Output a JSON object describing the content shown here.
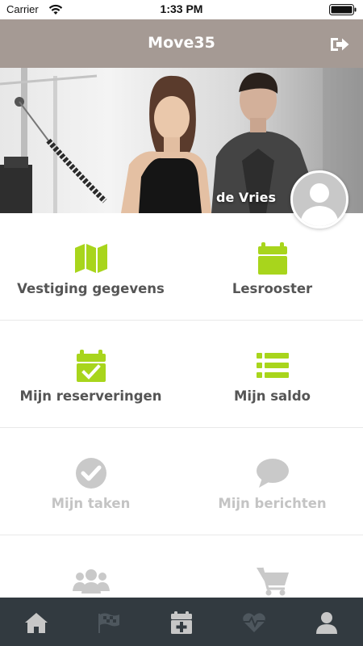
{
  "status_bar": {
    "carrier": "Carrier",
    "time": "1:33 PM"
  },
  "header": {
    "title": "Move35",
    "logout_icon": "sign-out-icon"
  },
  "profile": {
    "name": "de Vries",
    "avatar_icon": "user-avatar-icon"
  },
  "colors": {
    "accent": "#a8d51c",
    "header_bg": "#a59a94",
    "tabbar_bg": "#323a40",
    "muted": "#c9c9c9"
  },
  "menu": [
    {
      "label": "Vestiging gegevens",
      "icon": "map-icon",
      "enabled": true
    },
    {
      "label": "Lesrooster",
      "icon": "calendar-icon",
      "enabled": true
    },
    {
      "label": "Mijn reserveringen",
      "icon": "calendar-check-icon",
      "enabled": true
    },
    {
      "label": "Mijn saldo",
      "icon": "list-icon",
      "enabled": true
    },
    {
      "label": "Mijn taken",
      "icon": "check-circle-icon",
      "enabled": false
    },
    {
      "label": "Mijn berichten",
      "icon": "chat-icon",
      "enabled": false
    },
    {
      "label": "",
      "icon": "users-icon",
      "enabled": false
    },
    {
      "label": "",
      "icon": "shopping-cart-icon",
      "enabled": false
    }
  ],
  "tabs": [
    {
      "icon": "home-icon",
      "active": true
    },
    {
      "icon": "checkered-flag-icon",
      "active": false
    },
    {
      "icon": "calendar-plus-icon",
      "active": true
    },
    {
      "icon": "heartbeat-icon",
      "active": false
    },
    {
      "icon": "user-icon",
      "active": true
    }
  ]
}
